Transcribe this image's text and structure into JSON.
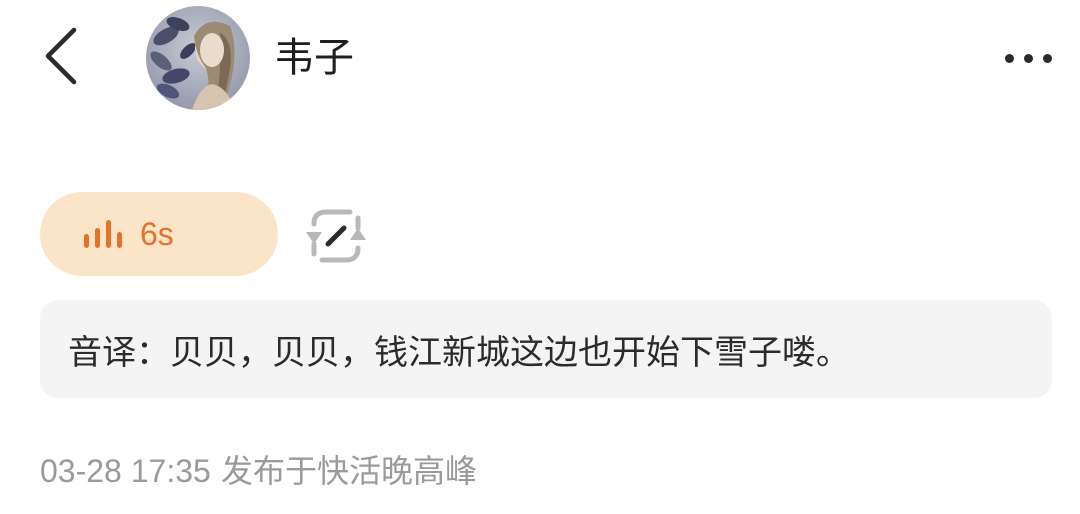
{
  "header": {
    "username": "韦子",
    "back_icon": "chevron-left-icon",
    "more_icon": "more-horizontal-icon"
  },
  "voice_message": {
    "duration": "6s",
    "icon": "sound-bars-icon",
    "accent_color": "#e8712a",
    "bubble_color": "#fbe5c8"
  },
  "edit_icon": "edit-refresh-icon",
  "transcript": {
    "text": "音译：贝贝，贝贝，钱江新城这边也开始下雪子喽。"
  },
  "meta": {
    "timestamp": "03-28 17:35",
    "publish_info": "发布于快活晚高峰"
  }
}
